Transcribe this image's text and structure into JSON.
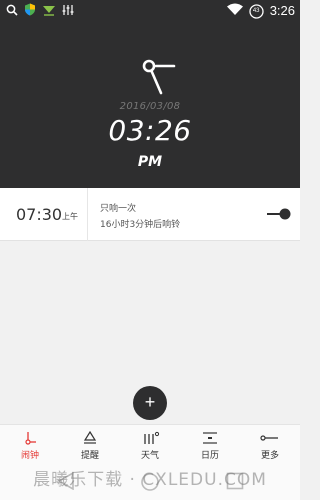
{
  "status_bar": {
    "time": "3:26",
    "battery_level": "43",
    "icons": [
      "search-icon",
      "shield-app-icon",
      "download-arrow-icon",
      "equalizer-icon",
      "wifi-icon",
      "battery-icon"
    ]
  },
  "header": {
    "date": "2016/03/08",
    "time": "03:26",
    "ampm": "PM",
    "icon": "alarm-clock-hand-icon"
  },
  "alarm": {
    "time": "07:30",
    "period": "上午",
    "repeat": "只响一次",
    "countdown": "16小时3分钟后响铃",
    "enabled": true
  },
  "fab": {
    "label": "+"
  },
  "bottom_nav": {
    "active": "alarm",
    "items": [
      {
        "id": "alarm",
        "label": "闹钟",
        "icon": "alarm-icon"
      },
      {
        "id": "reminder",
        "label": "提醒",
        "icon": "reminder-icon"
      },
      {
        "id": "weather",
        "label": "天气",
        "icon": "weather-icon"
      },
      {
        "id": "calendar",
        "label": "日历",
        "icon": "calendar-icon"
      },
      {
        "id": "more",
        "label": "更多",
        "icon": "more-icon"
      }
    ]
  },
  "watermark": {
    "text": "晨曦乐下载 · CXLEDU.COM"
  },
  "colors": {
    "header_bg": "#2e2e2f",
    "accent": "#e53935",
    "toggle": "#2e2e2f"
  }
}
